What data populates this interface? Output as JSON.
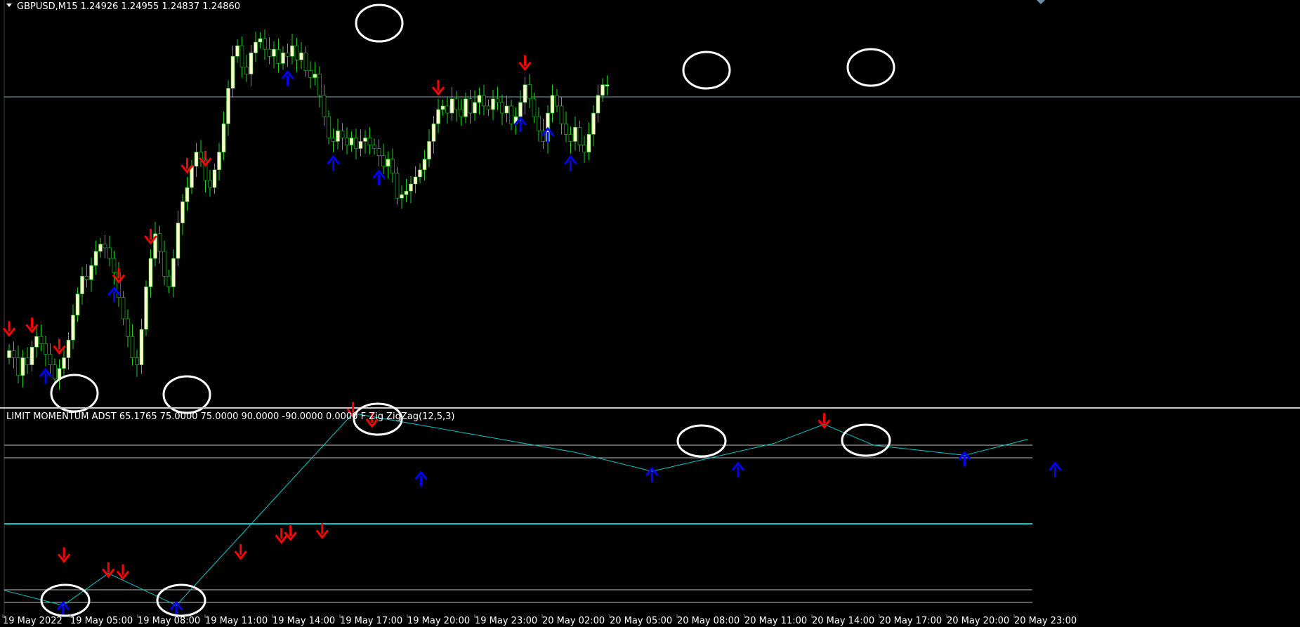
{
  "main_window": {
    "symbol_header": "GBPUSD,M15  1.24926 1.24955 1.24837 1.24860"
  },
  "indicator_window": {
    "header_text": "LIMIT MOMENTUM ADST 65.1765 75.0000  75.0000 90.0000 -90.0000 0.0000  F Zig   ZigZag(12,5,3)"
  },
  "time_axis": {
    "labels": [
      "19 May 2022",
      "19 May 05:00",
      "19 May 08:00",
      "19 May 11:00",
      "19 May 14:00",
      "19 May 17:00",
      "19 May 20:00",
      "19 May 23:00",
      "20 May 02:00",
      "20 May 05:00",
      "20 May 08:00",
      "20 May 11:00",
      "20 May 14:00",
      "20 May 17:00",
      "20 May 20:00",
      "20 May 23:00"
    ]
  },
  "colors": {
    "background": "#000000",
    "candle_up": "#ffffcc",
    "candle_down": "#000000",
    "candle_wick": "#22cc22",
    "sell_arrow": "#ff0000",
    "buy_arrow": "#0000ff",
    "zigzag": "#00cccc",
    "level_lines": "#c0c0c0",
    "highlight_circle": "#ffffff",
    "text": "#ffffff"
  },
  "chart_data": {
    "type": "candlestick",
    "symbol": "GBPUSD",
    "timeframe": "M15",
    "last_bar": {
      "open": 1.24926,
      "high": 1.24955,
      "low": 1.24837,
      "close": 1.2486
    },
    "close_series": [
      0.12,
      0.1,
      0.05,
      0.1,
      0.08,
      0.13,
      0.16,
      0.14,
      0.11,
      0.08,
      0.04,
      0.07,
      0.1,
      0.15,
      0.22,
      0.28,
      0.33,
      0.32,
      0.36,
      0.4,
      0.42,
      0.41,
      0.38,
      0.34,
      0.27,
      0.21,
      0.16,
      0.1,
      0.08,
      0.18,
      0.3,
      0.38,
      0.45,
      0.4,
      0.33,
      0.3,
      0.38,
      0.48,
      0.54,
      0.58,
      0.64,
      0.68,
      0.66,
      0.6,
      0.58,
      0.63,
      0.68,
      0.76,
      0.86,
      0.95,
      0.98,
      0.92,
      0.9,
      0.96,
      0.99,
      1.0,
      0.97,
      0.95,
      0.97,
      0.93,
      0.96,
      0.95,
      0.98,
      0.94,
      0.96,
      0.91,
      0.89,
      0.9,
      0.84,
      0.78,
      0.72,
      0.71,
      0.74,
      0.72,
      0.7,
      0.72,
      0.69,
      0.71,
      0.72,
      0.7,
      0.69,
      0.67,
      0.64,
      0.66,
      0.62,
      0.55,
      0.56,
      0.57,
      0.59,
      0.61,
      0.63,
      0.66,
      0.71,
      0.76,
      0.8,
      0.81,
      0.79,
      0.83,
      0.8,
      0.78,
      0.83,
      0.79,
      0.82,
      0.84,
      0.81,
      0.8,
      0.83,
      0.82,
      0.79,
      0.81,
      0.76,
      0.78,
      0.82,
      0.87,
      0.83,
      0.78,
      0.74,
      0.71,
      0.79,
      0.84,
      0.81,
      0.76,
      0.73,
      0.71,
      0.75,
      0.7,
      0.68,
      0.73,
      0.79,
      0.84,
      0.87,
      0.87
    ],
    "indicator": {
      "name": "LIMIT MOMENTUM ADST",
      "value": 65.1765,
      "levels": [
        75.0,
        75.0,
        90.0,
        -90.0,
        0.0
      ],
      "zigzag_params": "ZigZag(12,5,3)",
      "range": [
        -100,
        100
      ],
      "zigzag_points": [
        [
          0,
          -76
        ],
        [
          13,
          -91
        ],
        [
          23,
          -59
        ],
        [
          38,
          -91
        ],
        [
          77,
          101
        ],
        [
          126,
          62
        ],
        [
          143,
          43
        ],
        [
          170,
          71
        ],
        [
          181,
          90
        ],
        [
          192,
          69
        ],
        [
          212,
          59
        ],
        [
          226,
          75
        ]
      ]
    },
    "sell_signal_bars": [
      0,
      9,
      19,
      42,
      53,
      67,
      75,
      163,
      195
    ],
    "buy_signal_bars": [
      14,
      39,
      106,
      123,
      139,
      193,
      203,
      212
    ]
  }
}
